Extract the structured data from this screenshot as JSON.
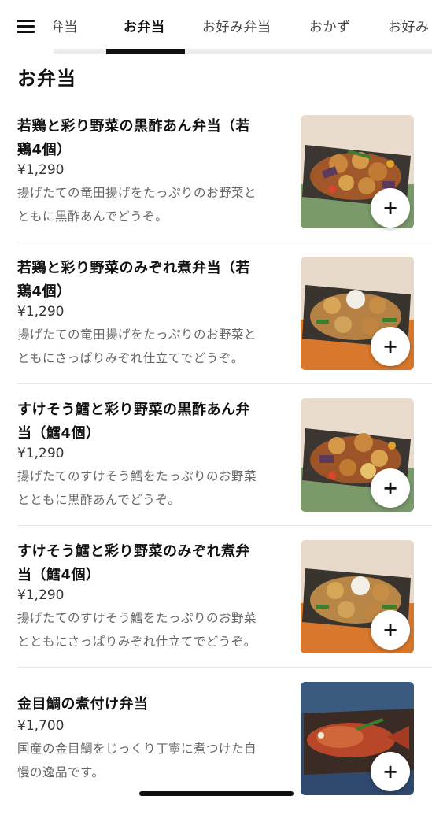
{
  "tabs": [
    {
      "label": "弁当"
    },
    {
      "label": "お弁当"
    },
    {
      "label": "お好み弁当"
    },
    {
      "label": "おかず"
    },
    {
      "label": "お好み"
    }
  ],
  "section_title": "お弁当",
  "add_button_label": "+",
  "items": [
    {
      "name_line1": "若鶏と彩り野菜の黒酢あん弁当（若",
      "name_line2": "鶏4個）",
      "price": "¥1,290",
      "desc_line1": "揚げたての竜田揚げをたっぷりのお野菜と",
      "desc_line2": "ともに黒酢あんでどうぞ。"
    },
    {
      "name_line1": "若鶏と彩り野菜のみぞれ煮弁当（若",
      "name_line2": "鶏4個）",
      "price": "¥1,290",
      "desc_line1": "揚げたての竜田揚げをたっぷりのお野菜と",
      "desc_line2": "ともにさっぱりみぞれ仕立てでどうぞ。"
    },
    {
      "name_line1": "すけそう鱈と彩り野菜の黒酢あん弁",
      "name_line2": "当（鱈4個）",
      "price": "¥1,290",
      "desc_line1": "揚げたてのすけそう鱈をたっぷりのお野菜",
      "desc_line2": "とともに黒酢あんでどうぞ。"
    },
    {
      "name_line1": "すけそう鱈と彩り野菜のみぞれ煮弁",
      "name_line2": "当（鱈4個）",
      "price": "¥1,290",
      "desc_line1": "揚げたてのすけそう鱈をたっぷりのお野菜",
      "desc_line2": "とともにさっぱりみぞれ仕立てでどうぞ。"
    },
    {
      "name_line1": "金目鯛の煮付け弁当",
      "name_line2": "",
      "price": "¥1,700",
      "desc_line1": "国産の金目鯛をじっくり丁寧に煮つけた自",
      "desc_line2": "慢の逸品です。"
    }
  ],
  "icons": {
    "menu": "list-menu-icon",
    "add": "plus-icon"
  },
  "colors": {
    "accent": "#111111",
    "muted_text": "#666666"
  }
}
